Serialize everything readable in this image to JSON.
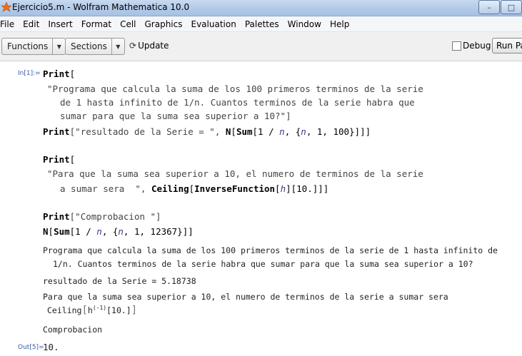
{
  "window": {
    "title": "Ejercicio5.m - Wolfram Mathematica 10.0",
    "buttons": [
      "–",
      "□"
    ]
  },
  "menu": [
    "File",
    "Edit",
    "Insert",
    "Format",
    "Cell",
    "Graphics",
    "Evaluation",
    "Palettes",
    "Window",
    "Help"
  ],
  "toolbar": {
    "functions_label": "Functions",
    "sections_label": "Sections",
    "update_label": "Update",
    "debug_label": "Debug",
    "run_label": "Run Pa"
  },
  "cells": {
    "in_label": "In[1]:=",
    "out_label": "Out[5]=",
    "code": {
      "l1_kw": "Print",
      "l1_rest": "[",
      "l2": "\"Programa que calcula la suma de los 100 primeros terminos de la serie",
      "l3": "de 1 hasta infinito de 1/n. Cuantos terminos de la serie habra que",
      "l4": "sumar para que la suma sea superior a 10?\"]",
      "l5_kw1": "Print",
      "l5_str": "[\"resultado de la Serie = \", ",
      "l5_kw2": "N",
      "l5_b1": "[",
      "l5_kw3": "Sum",
      "l5_b2": "[1 / ",
      "l5_n1": "n",
      "l5_b3": ", {",
      "l5_n2": "n",
      "l5_b4": ", 1, 100}]]]",
      "l6_kw": "Print",
      "l6_rest": "[",
      "l7": "\"Para que la suma sea superior a 10, el numero de terminos de la serie",
      "l8_str": "a sumar sera  \", ",
      "l8_kw1": "Ceiling",
      "l8_b1": "[",
      "l8_kw2": "InverseFunction",
      "l8_b2": "[",
      "l8_h": "h",
      "l8_b3": "][10.]]]",
      "l9_kw": "Print",
      "l9_str": "[\"Comprobacion \"]",
      "l10_kw1": "N",
      "l10_b1": "[",
      "l10_kw2": "Sum",
      "l10_b2": "[1 / ",
      "l10_n1": "n",
      "l10_b3": ", {",
      "l10_n2": "n",
      "l10_b4": ", 1, 12",
      "l10_b5": "367}]]"
    },
    "outputs": {
      "o1": "Programa que calcula la suma de los 100 primeros terminos de la serie de 1 hasta infinito de",
      "o2": "1/n. Cuantos terminos de la serie habra que sumar para que la suma sea superior a 10?",
      "o3": "resultado de la Serie = 5.18738",
      "o4": "Para que la suma sea superior a 10, el numero de terminos de la serie a sumar sera",
      "o5_a": "Ceiling",
      "o5_b": "h",
      "o5_sup": "(-1)",
      "o5_c": "[10.]",
      "o6": "Comprobacion",
      "o7": "10."
    }
  }
}
